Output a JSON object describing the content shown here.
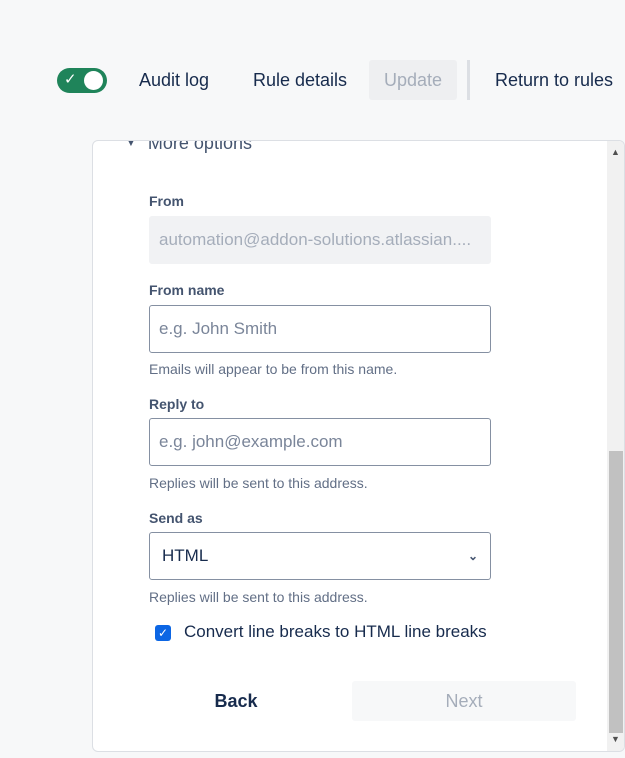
{
  "header": {
    "toggle_on": true,
    "audit_log": "Audit log",
    "rule_details": "Rule details",
    "update": "Update",
    "return": "Return to rules"
  },
  "form": {
    "more_options": "More options",
    "from_label": "From",
    "from_value": "automation@addon-solutions.atlassian....",
    "from_name_label": "From name",
    "from_name_placeholder": "e.g. John Smith",
    "from_name_help": "Emails will appear to be from this name.",
    "reply_to_label": "Reply to",
    "reply_to_placeholder": "e.g. john@example.com",
    "reply_to_help": "Replies will be sent to this address.",
    "send_as_label": "Send as",
    "send_as_value": "HTML",
    "send_as_help": "Replies will be sent to this address.",
    "convert_label": "Convert line breaks to HTML line breaks",
    "convert_checked": true,
    "back": "Back",
    "next": "Next"
  }
}
